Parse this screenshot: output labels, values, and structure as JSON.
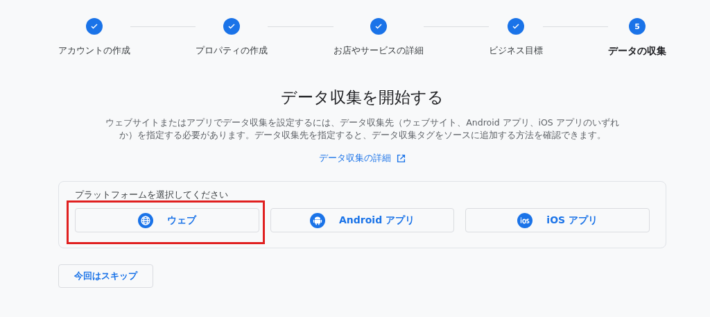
{
  "steps": [
    {
      "label": "アカウントの作成",
      "done": true,
      "selected": false
    },
    {
      "label": "プロパティの作成",
      "done": true,
      "selected": false
    },
    {
      "label": "お店やサービスの詳細",
      "done": true,
      "selected": false
    },
    {
      "label": "ビジネス目標",
      "done": true,
      "selected": false
    },
    {
      "label": "データの収集",
      "done": false,
      "number": "5",
      "selected": true
    }
  ],
  "heading": "データ収集を開始する",
  "description": "ウェブサイトまたはアプリでデータ収集を設定するには、データ収集先（ウェブサイト、Android アプリ、iOS アプリのいずれか）を指定する必要があります。データ収集先を指定すると、データ収集タグをソースに追加する方法を確認できます。",
  "learn_more_link": "データ収集の詳細",
  "platform_card": {
    "label": "プラットフォームを選択してください",
    "platforms": [
      {
        "kind": "web",
        "label": "ウェブ",
        "highlighted": true
      },
      {
        "kind": "android",
        "label": "Android アプリ",
        "highlighted": false
      },
      {
        "kind": "ios",
        "label": "iOS アプリ",
        "highlighted": false
      }
    ]
  },
  "skip_button": "今回はスキップ"
}
